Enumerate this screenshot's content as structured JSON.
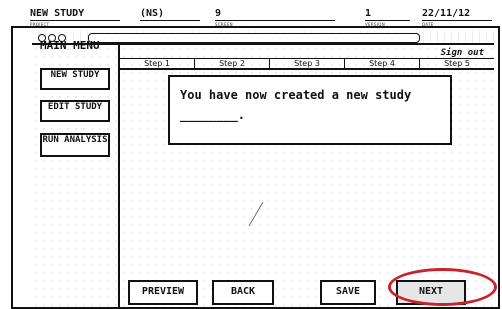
{
  "form": {
    "project_value": "NEW STUDY",
    "project_code": "(NS)",
    "screen_value": "9",
    "version_value": "1",
    "date_value": "22/11/12",
    "project_caption": "PROJECT",
    "screen_caption": "SCREEN",
    "version_caption": "VERSION",
    "date_caption": "DATE"
  },
  "sidebar": {
    "title": "MAIN MENU",
    "items": [
      {
        "label": "NEW STUDY"
      },
      {
        "label": "EDIT STUDY"
      },
      {
        "label": "RUN ANALYSIS"
      }
    ]
  },
  "header": {
    "signout": "Sign out"
  },
  "steps": [
    "Step 1",
    "Step 2",
    "Step 3",
    "Step 4",
    "Step 5"
  ],
  "message": "You have now created a new study ________.",
  "buttons": {
    "preview": "PREVIEW",
    "back": "BACK",
    "save": "SAVE",
    "next": "NEXT"
  },
  "colors": {
    "highlight": "#c8232d"
  }
}
